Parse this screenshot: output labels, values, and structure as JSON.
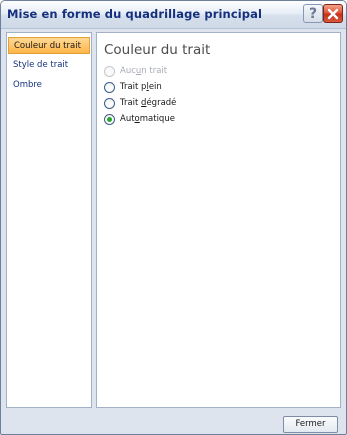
{
  "window": {
    "title": "Mise en forme du quadrillage principal"
  },
  "titlebar_buttons": {
    "help_symbol": "?"
  },
  "nav": {
    "items": [
      {
        "label": "Couleur du trait",
        "selected": true
      },
      {
        "label": "Style de trait",
        "selected": false
      },
      {
        "label": "Ombre",
        "selected": false
      }
    ]
  },
  "panel": {
    "title": "Couleur du trait",
    "options": [
      {
        "prefix": "Auc",
        "mnemonic": "u",
        "suffix": "n trait",
        "checked": false,
        "disabled": true
      },
      {
        "prefix": "Trait p",
        "mnemonic": "l",
        "suffix": "ein",
        "checked": false,
        "disabled": false
      },
      {
        "prefix": "Trait ",
        "mnemonic": "d",
        "suffix": "égradé",
        "checked": false,
        "disabled": false
      },
      {
        "prefix": "Aut",
        "mnemonic": "o",
        "suffix": "matique",
        "checked": true,
        "disabled": false
      }
    ]
  },
  "footer": {
    "close_label": "Fermer"
  },
  "colors": {
    "title_text": "#15317e",
    "selected_nav_bg": "#ffc064",
    "radio_checked": "#2aa52a",
    "close_button": "#d9462a"
  }
}
